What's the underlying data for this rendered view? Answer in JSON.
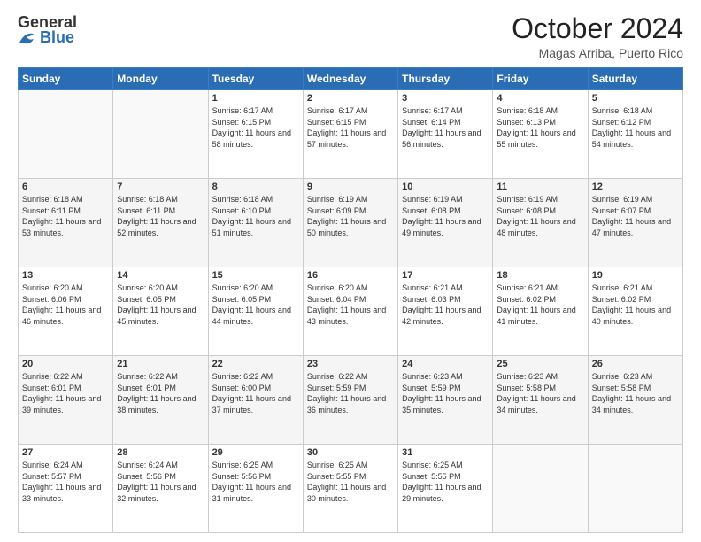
{
  "header": {
    "logo_line1": "General",
    "logo_line2": "Blue",
    "month_title": "October 2024",
    "location": "Magas Arriba, Puerto Rico"
  },
  "days_of_week": [
    "Sunday",
    "Monday",
    "Tuesday",
    "Wednesday",
    "Thursday",
    "Friday",
    "Saturday"
  ],
  "weeks": [
    [
      {
        "day": "",
        "sunrise": "",
        "sunset": "",
        "daylight": ""
      },
      {
        "day": "",
        "sunrise": "",
        "sunset": "",
        "daylight": ""
      },
      {
        "day": "1",
        "sunrise": "Sunrise: 6:17 AM",
        "sunset": "Sunset: 6:15 PM",
        "daylight": "Daylight: 11 hours and 58 minutes."
      },
      {
        "day": "2",
        "sunrise": "Sunrise: 6:17 AM",
        "sunset": "Sunset: 6:15 PM",
        "daylight": "Daylight: 11 hours and 57 minutes."
      },
      {
        "day": "3",
        "sunrise": "Sunrise: 6:17 AM",
        "sunset": "Sunset: 6:14 PM",
        "daylight": "Daylight: 11 hours and 56 minutes."
      },
      {
        "day": "4",
        "sunrise": "Sunrise: 6:18 AM",
        "sunset": "Sunset: 6:13 PM",
        "daylight": "Daylight: 11 hours and 55 minutes."
      },
      {
        "day": "5",
        "sunrise": "Sunrise: 6:18 AM",
        "sunset": "Sunset: 6:12 PM",
        "daylight": "Daylight: 11 hours and 54 minutes."
      }
    ],
    [
      {
        "day": "6",
        "sunrise": "Sunrise: 6:18 AM",
        "sunset": "Sunset: 6:11 PM",
        "daylight": "Daylight: 11 hours and 53 minutes."
      },
      {
        "day": "7",
        "sunrise": "Sunrise: 6:18 AM",
        "sunset": "Sunset: 6:11 PM",
        "daylight": "Daylight: 11 hours and 52 minutes."
      },
      {
        "day": "8",
        "sunrise": "Sunrise: 6:18 AM",
        "sunset": "Sunset: 6:10 PM",
        "daylight": "Daylight: 11 hours and 51 minutes."
      },
      {
        "day": "9",
        "sunrise": "Sunrise: 6:19 AM",
        "sunset": "Sunset: 6:09 PM",
        "daylight": "Daylight: 11 hours and 50 minutes."
      },
      {
        "day": "10",
        "sunrise": "Sunrise: 6:19 AM",
        "sunset": "Sunset: 6:08 PM",
        "daylight": "Daylight: 11 hours and 49 minutes."
      },
      {
        "day": "11",
        "sunrise": "Sunrise: 6:19 AM",
        "sunset": "Sunset: 6:08 PM",
        "daylight": "Daylight: 11 hours and 48 minutes."
      },
      {
        "day": "12",
        "sunrise": "Sunrise: 6:19 AM",
        "sunset": "Sunset: 6:07 PM",
        "daylight": "Daylight: 11 hours and 47 minutes."
      }
    ],
    [
      {
        "day": "13",
        "sunrise": "Sunrise: 6:20 AM",
        "sunset": "Sunset: 6:06 PM",
        "daylight": "Daylight: 11 hours and 46 minutes."
      },
      {
        "day": "14",
        "sunrise": "Sunrise: 6:20 AM",
        "sunset": "Sunset: 6:05 PM",
        "daylight": "Daylight: 11 hours and 45 minutes."
      },
      {
        "day": "15",
        "sunrise": "Sunrise: 6:20 AM",
        "sunset": "Sunset: 6:05 PM",
        "daylight": "Daylight: 11 hours and 44 minutes."
      },
      {
        "day": "16",
        "sunrise": "Sunrise: 6:20 AM",
        "sunset": "Sunset: 6:04 PM",
        "daylight": "Daylight: 11 hours and 43 minutes."
      },
      {
        "day": "17",
        "sunrise": "Sunrise: 6:21 AM",
        "sunset": "Sunset: 6:03 PM",
        "daylight": "Daylight: 11 hours and 42 minutes."
      },
      {
        "day": "18",
        "sunrise": "Sunrise: 6:21 AM",
        "sunset": "Sunset: 6:02 PM",
        "daylight": "Daylight: 11 hours and 41 minutes."
      },
      {
        "day": "19",
        "sunrise": "Sunrise: 6:21 AM",
        "sunset": "Sunset: 6:02 PM",
        "daylight": "Daylight: 11 hours and 40 minutes."
      }
    ],
    [
      {
        "day": "20",
        "sunrise": "Sunrise: 6:22 AM",
        "sunset": "Sunset: 6:01 PM",
        "daylight": "Daylight: 11 hours and 39 minutes."
      },
      {
        "day": "21",
        "sunrise": "Sunrise: 6:22 AM",
        "sunset": "Sunset: 6:01 PM",
        "daylight": "Daylight: 11 hours and 38 minutes."
      },
      {
        "day": "22",
        "sunrise": "Sunrise: 6:22 AM",
        "sunset": "Sunset: 6:00 PM",
        "daylight": "Daylight: 11 hours and 37 minutes."
      },
      {
        "day": "23",
        "sunrise": "Sunrise: 6:22 AM",
        "sunset": "Sunset: 5:59 PM",
        "daylight": "Daylight: 11 hours and 36 minutes."
      },
      {
        "day": "24",
        "sunrise": "Sunrise: 6:23 AM",
        "sunset": "Sunset: 5:59 PM",
        "daylight": "Daylight: 11 hours and 35 minutes."
      },
      {
        "day": "25",
        "sunrise": "Sunrise: 6:23 AM",
        "sunset": "Sunset: 5:58 PM",
        "daylight": "Daylight: 11 hours and 34 minutes."
      },
      {
        "day": "26",
        "sunrise": "Sunrise: 6:23 AM",
        "sunset": "Sunset: 5:58 PM",
        "daylight": "Daylight: 11 hours and 34 minutes."
      }
    ],
    [
      {
        "day": "27",
        "sunrise": "Sunrise: 6:24 AM",
        "sunset": "Sunset: 5:57 PM",
        "daylight": "Daylight: 11 hours and 33 minutes."
      },
      {
        "day": "28",
        "sunrise": "Sunrise: 6:24 AM",
        "sunset": "Sunset: 5:56 PM",
        "daylight": "Daylight: 11 hours and 32 minutes."
      },
      {
        "day": "29",
        "sunrise": "Sunrise: 6:25 AM",
        "sunset": "Sunset: 5:56 PM",
        "daylight": "Daylight: 11 hours and 31 minutes."
      },
      {
        "day": "30",
        "sunrise": "Sunrise: 6:25 AM",
        "sunset": "Sunset: 5:55 PM",
        "daylight": "Daylight: 11 hours and 30 minutes."
      },
      {
        "day": "31",
        "sunrise": "Sunrise: 6:25 AM",
        "sunset": "Sunset: 5:55 PM",
        "daylight": "Daylight: 11 hours and 29 minutes."
      },
      {
        "day": "",
        "sunrise": "",
        "sunset": "",
        "daylight": ""
      },
      {
        "day": "",
        "sunrise": "",
        "sunset": "",
        "daylight": ""
      }
    ]
  ]
}
